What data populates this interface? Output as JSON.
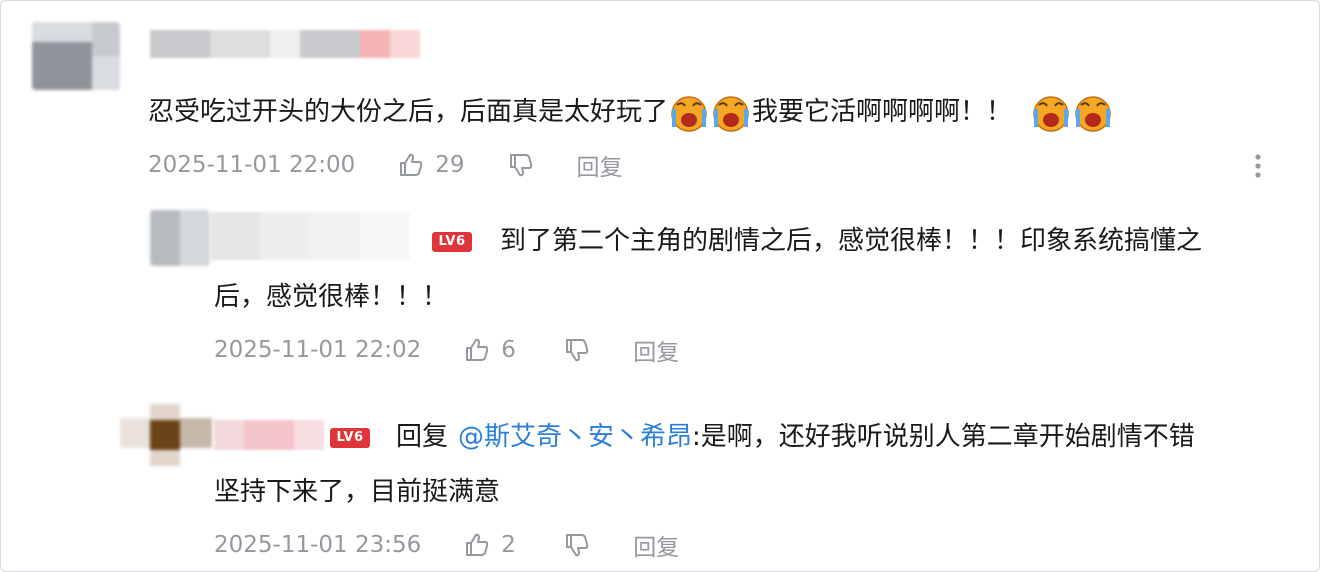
{
  "comments": [
    {
      "text_a": "忍受吃过开头的大份之后，后面真是太好玩了",
      "text_b": "我要它活啊啊啊啊！！",
      "emoji": "crying-face-emoji",
      "time": "2025-11-01 22:00",
      "likes": "29",
      "reply_label": "回复"
    },
    {
      "level_badge": "LV6",
      "text_line1": "到了第二个主角的剧情之后，感觉很棒！！！印象系统搞懂之",
      "text_line2": "后，感觉很棒！！！",
      "time": "2025-11-01 22:02",
      "likes": "6",
      "reply_label": "回复"
    },
    {
      "level_badge": "LV6",
      "reply_prefix": "回复",
      "mention": "@斯艾奇丶安丶希昂",
      "text_line1": ":是啊，还好我听说别人第二章开始剧情不错",
      "text_line2": "坚持下来了，目前挺满意",
      "time": "2025-11-01 23:56",
      "likes": "2",
      "reply_label": "回复"
    }
  ],
  "colors": {
    "meta": "#9499a0",
    "mention": "#2b7fd8",
    "level_badge": "#e0343b"
  },
  "more_icon": "vertical-dots-icon"
}
